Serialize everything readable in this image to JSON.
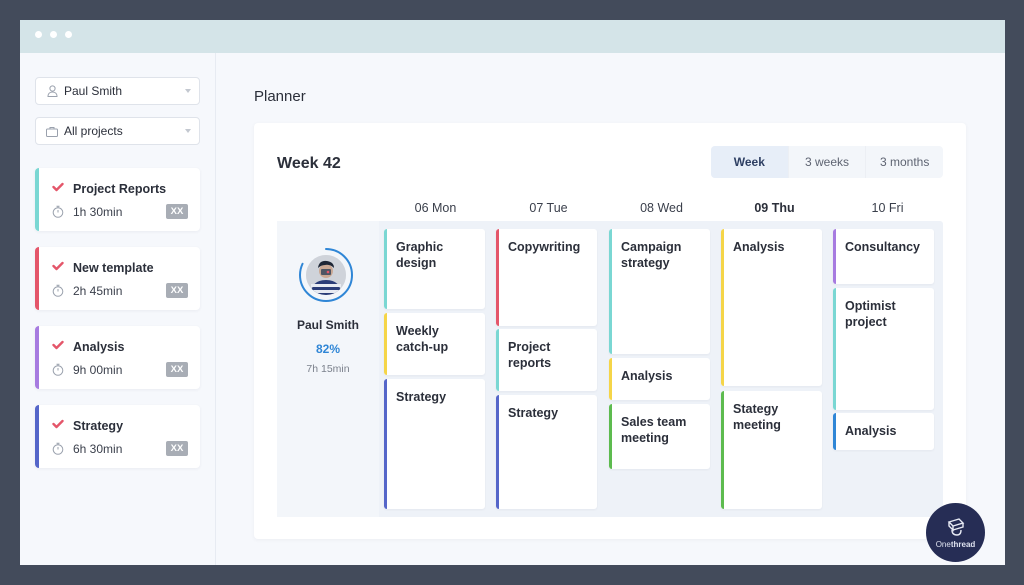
{
  "window": {
    "dots": 3
  },
  "sidebar": {
    "user_select": {
      "value": "Paul Smith",
      "icon": "person-icon"
    },
    "project_select": {
      "value": "All projects",
      "icon": "briefcase-icon"
    },
    "tasks": [
      {
        "name": "Project Reports",
        "time": "1h 30min",
        "tag": "XX",
        "color": "#7ad7d3"
      },
      {
        "name": "New template",
        "time": "2h 45min",
        "tag": "XX",
        "color": "#e4566a"
      },
      {
        "name": "Analysis",
        "time": "9h 00min",
        "tag": "XX",
        "color": "#a77be0"
      },
      {
        "name": "Strategy",
        "time": "6h 30min",
        "tag": "XX",
        "color": "#5566c9"
      }
    ],
    "check_color": "#e4566a"
  },
  "main": {
    "title": "Planner",
    "week_title": "Week 42",
    "views": [
      {
        "label": "Week",
        "active": true
      },
      {
        "label": "3 weeks",
        "active": false
      },
      {
        "label": "3 months",
        "active": false
      }
    ],
    "days": [
      {
        "label": "06 Mon",
        "today": false
      },
      {
        "label": "07 Tue",
        "today": false
      },
      {
        "label": "08 Wed",
        "today": false
      },
      {
        "label": "09 Thu",
        "today": true
      },
      {
        "label": "10 Fri",
        "today": false
      }
    ],
    "person": {
      "name": "Paul Smith",
      "progress_percent": 82,
      "progress_label": "82%",
      "hours": "7h 15min",
      "accent": "#2f86d6"
    },
    "events": [
      [
        {
          "title": "Graphic design",
          "color": "#7ad7d3"
        },
        {
          "title": "Weekly catch-up",
          "color": "#f5d548"
        },
        {
          "title": "Strategy",
          "color": "#5566c9"
        }
      ],
      [
        {
          "title": "Copywriting",
          "color": "#e4566a"
        },
        {
          "title": "Project reports",
          "color": "#7ad7d3"
        },
        {
          "title": "Strategy",
          "color": "#5566c9"
        }
      ],
      [
        {
          "title": "Campaign strategy",
          "color": "#7ad7d3"
        },
        {
          "title": "Analysis",
          "color": "#f5d548"
        },
        {
          "title": "Sales team meeting",
          "color": "#5dbb4f"
        }
      ],
      [
        {
          "title": "Analysis",
          "color": "#f5d548"
        },
        {
          "title": "Stategy meeting",
          "color": "#5dbb4f"
        }
      ],
      [
        {
          "title": "Consultancy",
          "color": "#a77be0"
        },
        {
          "title": "Optimist project",
          "color": "#7ad7d3"
        },
        {
          "title": "Analysis",
          "color": "#2f86d6"
        }
      ]
    ]
  },
  "brand": {
    "prefix": "One",
    "suffix": "thread"
  }
}
